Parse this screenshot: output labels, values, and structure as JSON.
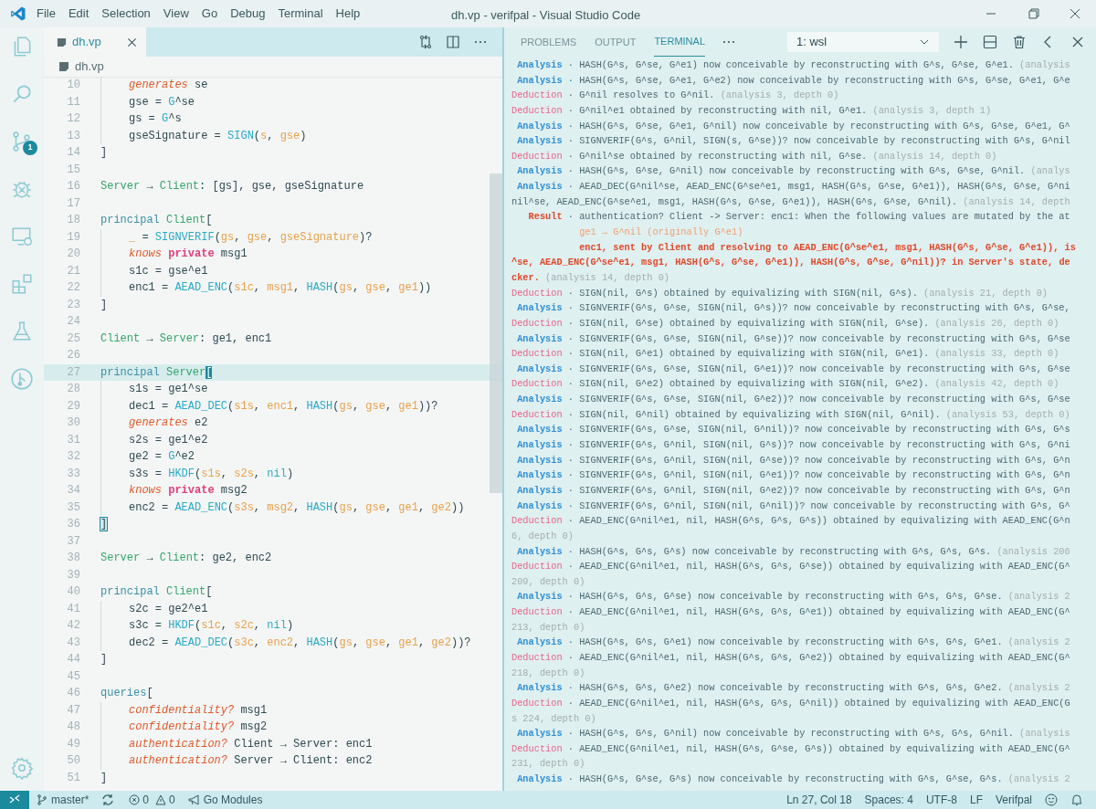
{
  "title_bar": {
    "menu": [
      "File",
      "Edit",
      "Selection",
      "View",
      "Go",
      "Debug",
      "Terminal",
      "Help"
    ],
    "title": "dh.vp - verifpal - Visual Studio Code"
  },
  "activity_bar": {
    "badge": "1"
  },
  "editor": {
    "tabs": [
      {
        "label": "dh.vp",
        "selected": true
      }
    ],
    "breadcrumb": "dh.vp",
    "lines": [
      {
        "num": "10",
        "indent": true,
        "current": false,
        "tokens": [
          {
            "kind": "directive",
            "text": "generates"
          },
          {
            "kind": "plain",
            "text": " se"
          }
        ]
      },
      {
        "num": "11",
        "indent": true,
        "current": false,
        "tokens": [
          {
            "kind": "plain",
            "text": "gse = "
          },
          {
            "kind": "function",
            "text": "G"
          },
          {
            "kind": "plain",
            "text": "^se"
          }
        ]
      },
      {
        "num": "12",
        "indent": true,
        "current": false,
        "tokens": [
          {
            "kind": "plain",
            "text": "gs = "
          },
          {
            "kind": "function",
            "text": "G"
          },
          {
            "kind": "plain",
            "text": "^s"
          }
        ]
      },
      {
        "num": "13",
        "indent": true,
        "current": false,
        "tokens": [
          {
            "kind": "plain",
            "text": "gseSignature = "
          },
          {
            "kind": "function",
            "text": "SIGN"
          },
          {
            "kind": "plain",
            "text": "("
          },
          {
            "kind": "argument",
            "text": "s"
          },
          {
            "kind": "plain",
            "text": ", "
          },
          {
            "kind": "argument",
            "text": "gse"
          },
          {
            "kind": "plain",
            "text": ")"
          }
        ]
      },
      {
        "num": "14",
        "indent": false,
        "current": false,
        "tokens": [
          {
            "kind": "plain",
            "text": "]"
          }
        ]
      },
      {
        "num": "15",
        "indent": false,
        "current": false
      },
      {
        "num": "16",
        "indent": false,
        "current": false,
        "tokens": [
          {
            "kind": "name",
            "text": "Server"
          },
          {
            "kind": "plain",
            "text": " → "
          },
          {
            "kind": "name",
            "text": "Client"
          },
          {
            "kind": "plain",
            "text": ": [gs], gse, gseSignature"
          }
        ]
      },
      {
        "num": "17",
        "indent": false,
        "current": false
      },
      {
        "num": "18",
        "indent": false,
        "current": false,
        "tokens": [
          {
            "kind": "keyword",
            "text": "principal"
          },
          {
            "kind": "name",
            "text": " Client"
          },
          {
            "kind": "plain",
            "text": "["
          }
        ]
      },
      {
        "num": "19",
        "indent": true,
        "current": false,
        "tokens": [
          {
            "kind": "argument",
            "text": "_"
          },
          {
            "kind": "plain",
            "text": " = "
          },
          {
            "kind": "function",
            "text": "SIGNVERIF"
          },
          {
            "kind": "plain",
            "text": "("
          },
          {
            "kind": "argument",
            "text": "gs"
          },
          {
            "kind": "plain",
            "text": ", "
          },
          {
            "kind": "argument",
            "text": "gse"
          },
          {
            "kind": "plain",
            "text": ", "
          },
          {
            "kind": "argument",
            "text": "gseSignature"
          },
          {
            "kind": "plain",
            "text": ")?"
          }
        ]
      },
      {
        "num": "20",
        "indent": true,
        "current": false,
        "tokens": [
          {
            "kind": "directive",
            "text": "knows"
          },
          {
            "kind": "qualifier",
            "text": " private"
          },
          {
            "kind": "plain",
            "text": " msg1"
          }
        ]
      },
      {
        "num": "21",
        "indent": true,
        "current": false,
        "tokens": [
          {
            "kind": "plain",
            "text": "s1c = gse^e1"
          }
        ]
      },
      {
        "num": "22",
        "indent": true,
        "current": false,
        "tokens": [
          {
            "kind": "plain",
            "text": "enc1 = "
          },
          {
            "kind": "function",
            "text": "AEAD_ENC"
          },
          {
            "kind": "plain",
            "text": "("
          },
          {
            "kind": "argument",
            "text": "s1c"
          },
          {
            "kind": "plain",
            "text": ", "
          },
          {
            "kind": "argument",
            "text": "msg1"
          },
          {
            "kind": "plain",
            "text": ", "
          },
          {
            "kind": "function",
            "text": "HASH"
          },
          {
            "kind": "plain",
            "text": "("
          },
          {
            "kind": "argument",
            "text": "gs"
          },
          {
            "kind": "plain",
            "text": ", "
          },
          {
            "kind": "argument",
            "text": "gse"
          },
          {
            "kind": "plain",
            "text": ", "
          },
          {
            "kind": "argument",
            "text": "ge1"
          },
          {
            "kind": "plain",
            "text": "))"
          }
        ]
      },
      {
        "num": "23",
        "indent": false,
        "current": false,
        "tokens": [
          {
            "kind": "plain",
            "text": "]"
          }
        ]
      },
      {
        "num": "24",
        "indent": false,
        "current": false
      },
      {
        "num": "25",
        "indent": false,
        "current": false,
        "tokens": [
          {
            "kind": "name",
            "text": "Client"
          },
          {
            "kind": "plain",
            "text": " → "
          },
          {
            "kind": "name",
            "text": "Server"
          },
          {
            "kind": "plain",
            "text": ": ge1, enc1"
          }
        ]
      },
      {
        "num": "26",
        "indent": false,
        "current": false
      },
      {
        "num": "27",
        "indent": false,
        "current": true,
        "tokens": [
          {
            "kind": "keyword",
            "text": "principal"
          },
          {
            "kind": "name",
            "text": " Server"
          },
          {
            "kind": "cursor",
            "text": "["
          }
        ]
      },
      {
        "num": "28",
        "indent": true,
        "current": false,
        "tokens": [
          {
            "kind": "plain",
            "text": "s1s = ge1^se"
          }
        ]
      },
      {
        "num": "29",
        "indent": true,
        "current": false,
        "tokens": [
          {
            "kind": "plain",
            "text": "dec1 = "
          },
          {
            "kind": "function",
            "text": "AEAD_DEC"
          },
          {
            "kind": "plain",
            "text": "("
          },
          {
            "kind": "argument",
            "text": "s1s"
          },
          {
            "kind": "plain",
            "text": ", "
          },
          {
            "kind": "argument",
            "text": "enc1"
          },
          {
            "kind": "plain",
            "text": ", "
          },
          {
            "kind": "function",
            "text": "HASH"
          },
          {
            "kind": "plain",
            "text": "("
          },
          {
            "kind": "argument",
            "text": "gs"
          },
          {
            "kind": "plain",
            "text": ", "
          },
          {
            "kind": "argument",
            "text": "gse"
          },
          {
            "kind": "plain",
            "text": ", "
          },
          {
            "kind": "argument",
            "text": "ge1"
          },
          {
            "kind": "plain",
            "text": "))?"
          }
        ]
      },
      {
        "num": "30",
        "indent": true,
        "current": false,
        "tokens": [
          {
            "kind": "directive",
            "text": "generates"
          },
          {
            "kind": "plain",
            "text": " e2"
          }
        ]
      },
      {
        "num": "31",
        "indent": true,
        "current": false,
        "tokens": [
          {
            "kind": "plain",
            "text": "s2s = ge1^e2"
          }
        ]
      },
      {
        "num": "32",
        "indent": true,
        "current": false,
        "tokens": [
          {
            "kind": "plain",
            "text": "ge2 = "
          },
          {
            "kind": "function",
            "text": "G"
          },
          {
            "kind": "plain",
            "text": "^e2"
          }
        ]
      },
      {
        "num": "33",
        "indent": true,
        "current": false,
        "tokens": [
          {
            "kind": "plain",
            "text": "s3s = "
          },
          {
            "kind": "function",
            "text": "HKDF"
          },
          {
            "kind": "plain",
            "text": "("
          },
          {
            "kind": "argument",
            "text": "s1s"
          },
          {
            "kind": "plain",
            "text": ", "
          },
          {
            "kind": "argument",
            "text": "s2s"
          },
          {
            "kind": "plain",
            "text": ", "
          },
          {
            "kind": "function",
            "text": "nil"
          },
          {
            "kind": "plain",
            "text": ")"
          }
        ]
      },
      {
        "num": "34",
        "indent": true,
        "current": false,
        "tokens": [
          {
            "kind": "directive",
            "text": "knows"
          },
          {
            "kind": "qualifier",
            "text": " private"
          },
          {
            "kind": "plain",
            "text": " msg2"
          }
        ]
      },
      {
        "num": "35",
        "indent": true,
        "current": false,
        "tokens": [
          {
            "kind": "plain",
            "text": "enc2 = "
          },
          {
            "kind": "function",
            "text": "AEAD_ENC"
          },
          {
            "kind": "plain",
            "text": "("
          },
          {
            "kind": "argument",
            "text": "s3s"
          },
          {
            "kind": "plain",
            "text": ", "
          },
          {
            "kind": "argument",
            "text": "msg2"
          },
          {
            "kind": "plain",
            "text": ", "
          },
          {
            "kind": "function",
            "text": "HASH"
          },
          {
            "kind": "plain",
            "text": "("
          },
          {
            "kind": "argument",
            "text": "gs"
          },
          {
            "kind": "plain",
            "text": ", "
          },
          {
            "kind": "argument",
            "text": "gse"
          },
          {
            "kind": "plain",
            "text": ", "
          },
          {
            "kind": "argument",
            "text": "ge1"
          },
          {
            "kind": "plain",
            "text": ", "
          },
          {
            "kind": "argument",
            "text": "ge2"
          },
          {
            "kind": "plain",
            "text": "))"
          }
        ]
      },
      {
        "num": "36",
        "indent": false,
        "current": false,
        "tokens": [
          {
            "kind": "match",
            "text": "]"
          }
        ]
      },
      {
        "num": "37",
        "indent": false,
        "current": false
      },
      {
        "num": "38",
        "indent": false,
        "current": false,
        "tokens": [
          {
            "kind": "name",
            "text": "Server"
          },
          {
            "kind": "plain",
            "text": " → "
          },
          {
            "kind": "name",
            "text": "Client"
          },
          {
            "kind": "plain",
            "text": ": ge2, enc2"
          }
        ]
      },
      {
        "num": "39",
        "indent": false,
        "current": false
      },
      {
        "num": "40",
        "indent": false,
        "current": false,
        "tokens": [
          {
            "kind": "keyword",
            "text": "principal"
          },
          {
            "kind": "name",
            "text": " Client"
          },
          {
            "kind": "plain",
            "text": "["
          }
        ]
      },
      {
        "num": "41",
        "indent": true,
        "current": false,
        "tokens": [
          {
            "kind": "plain",
            "text": "s2c = ge2^e1"
          }
        ]
      },
      {
        "num": "42",
        "indent": true,
        "current": false,
        "tokens": [
          {
            "kind": "plain",
            "text": "s3c = "
          },
          {
            "kind": "function",
            "text": "HKDF"
          },
          {
            "kind": "plain",
            "text": "("
          },
          {
            "kind": "argument",
            "text": "s1c"
          },
          {
            "kind": "plain",
            "text": ", "
          },
          {
            "kind": "argument",
            "text": "s2c"
          },
          {
            "kind": "plain",
            "text": ", "
          },
          {
            "kind": "function",
            "text": "nil"
          },
          {
            "kind": "plain",
            "text": ")"
          }
        ]
      },
      {
        "num": "43",
        "indent": true,
        "current": false,
        "tokens": [
          {
            "kind": "plain",
            "text": "dec2 = "
          },
          {
            "kind": "function",
            "text": "AEAD_DEC"
          },
          {
            "kind": "plain",
            "text": "("
          },
          {
            "kind": "argument",
            "text": "s3c"
          },
          {
            "kind": "plain",
            "text": ", "
          },
          {
            "kind": "argument",
            "text": "enc2"
          },
          {
            "kind": "plain",
            "text": ", "
          },
          {
            "kind": "function",
            "text": "HASH"
          },
          {
            "kind": "plain",
            "text": "("
          },
          {
            "kind": "argument",
            "text": "gs"
          },
          {
            "kind": "plain",
            "text": ", "
          },
          {
            "kind": "argument",
            "text": "gse"
          },
          {
            "kind": "plain",
            "text": ", "
          },
          {
            "kind": "argument",
            "text": "ge1"
          },
          {
            "kind": "plain",
            "text": ", "
          },
          {
            "kind": "argument",
            "text": "ge2"
          },
          {
            "kind": "plain",
            "text": "))?"
          }
        ]
      },
      {
        "num": "44",
        "indent": false,
        "current": false,
        "tokens": [
          {
            "kind": "plain",
            "text": "]"
          }
        ]
      },
      {
        "num": "45",
        "indent": false,
        "current": false
      },
      {
        "num": "46",
        "indent": false,
        "current": false,
        "tokens": [
          {
            "kind": "keyword",
            "text": "queries"
          },
          {
            "kind": "plain",
            "text": "["
          }
        ]
      },
      {
        "num": "47",
        "indent": true,
        "current": false,
        "tokens": [
          {
            "kind": "directive",
            "text": "confidentiality?"
          },
          {
            "kind": "plain",
            "text": " msg1"
          }
        ]
      },
      {
        "num": "48",
        "indent": true,
        "current": false,
        "tokens": [
          {
            "kind": "directive",
            "text": "confidentiality?"
          },
          {
            "kind": "plain",
            "text": " msg2"
          }
        ]
      },
      {
        "num": "49",
        "indent": true,
        "current": false,
        "tokens": [
          {
            "kind": "directive",
            "text": "authentication?"
          },
          {
            "kind": "plain",
            "text": " Client → Server: enc1"
          }
        ]
      },
      {
        "num": "50",
        "indent": true,
        "current": false,
        "tokens": [
          {
            "kind": "directive",
            "text": "authentication?"
          },
          {
            "kind": "plain",
            "text": " Server → Client: enc2"
          }
        ]
      },
      {
        "num": "51",
        "indent": false,
        "current": false,
        "tokens": [
          {
            "kind": "plain",
            "text": "]"
          }
        ]
      }
    ]
  },
  "panel": {
    "tabs": [
      {
        "label": "PROBLEMS",
        "selected": false
      },
      {
        "label": "OUTPUT",
        "selected": false
      },
      {
        "label": "TERMINAL",
        "selected": true
      }
    ],
    "terminal_select": "1: wsl",
    "lines": [
      {
        "kind": "analysis",
        "label": "Analysis",
        "text": "· HASH(G^s, G^se, G^e1) now conceivable by reconstructing with G^s, G^se, G^e1.",
        "note": "(analysis"
      },
      {
        "kind": "analysis",
        "label": "Analysis",
        "text": "· HASH(G^s, G^se, G^e1, G^e2) now conceivable by reconstructing with G^s, G^se, G^e1, G^e"
      },
      {
        "kind": "deduction",
        "label": "Deduction",
        "text": "· G^nil resolves to G^nil.",
        "note": "(analysis 3, depth 0)"
      },
      {
        "kind": "deduction",
        "label": "Deduction",
        "text": "· G^nil^e1 obtained by reconstructing with nil, G^e1.",
        "note": "(analysis 3, depth 1)"
      },
      {
        "kind": "analysis",
        "label": "Analysis",
        "text": "· HASH(G^s, G^se, G^e1, G^nil) now conceivable by reconstructing with G^s, G^se, G^e1, G^"
      },
      {
        "kind": "analysis",
        "label": "Analysis",
        "text": "· SIGNVERIF(G^s, G^nil, SIGN(s, G^se))? now conceivable by reconstructing with G^s, G^nil"
      },
      {
        "kind": "deduction",
        "label": "Deduction",
        "text": "· G^nil^se obtained by reconstructing with nil, G^se.",
        "note": "(analysis 14, depth 0)"
      },
      {
        "kind": "analysis",
        "label": "Analysis",
        "text": "· HASH(G^s, G^se, G^nil) now conceivable by reconstructing with G^s, G^se, G^nil.",
        "note": "(analys"
      },
      {
        "kind": "analysis",
        "label": "Analysis",
        "text": "· AEAD_DEC(G^nil^se, AEAD_ENC(G^se^e1, msg1, HASH(G^s, G^se, G^e1)), HASH(G^s, G^se, G^ni"
      },
      {
        "kind": "continuation",
        "text": "nil^se, AEAD_ENC(G^se^e1, msg1, HASH(G^s, G^se, G^e1)), HASH(G^s, G^se, G^nil).",
        "note": "(analysis 14, depth"
      },
      {
        "kind": "result",
        "label": "Result",
        "text": "· authentication? Client -> Server: enc1: When the following values are mutated by the at"
      },
      {
        "kind": "mutation",
        "text": "ge1 → G^nil (originally G^e1)"
      },
      {
        "kind": "verdict",
        "indent": true,
        "text": "enc1, sent by Client and resolving to AEAD_ENC(G^se^e1, msg1, HASH(G^s, G^se, G^e1)), is"
      },
      {
        "kind": "verdict",
        "indent": false,
        "text": "^se, AEAD_ENC(G^se^e1, msg1, HASH(G^s, G^se, G^e1)), HASH(G^s, G^se, G^nil))? in Server's state, de"
      },
      {
        "kind": "verdict",
        "indent": false,
        "text": "cker.",
        "note": "(analysis 14, depth 0)"
      },
      {
        "kind": "deduction",
        "label": "Deduction",
        "text": "· SIGN(nil, G^s) obtained by equivalizing with SIGN(nil, G^s).",
        "note": "(analysis 21, depth 0)"
      },
      {
        "kind": "analysis",
        "label": "Analysis",
        "text": "· SIGNVERIF(G^s, G^se, SIGN(nil, G^s))? now conceivable by reconstructing with G^s, G^se,"
      },
      {
        "kind": "deduction",
        "label": "Deduction",
        "text": "· SIGN(nil, G^se) obtained by equivalizing with SIGN(nil, G^se).",
        "note": "(analysis 26, depth 0)"
      },
      {
        "kind": "analysis",
        "label": "Analysis",
        "text": "· SIGNVERIF(G^s, G^se, SIGN(nil, G^se))? now conceivable by reconstructing with G^s, G^se"
      },
      {
        "kind": "deduction",
        "label": "Deduction",
        "text": "· SIGN(nil, G^e1) obtained by equivalizing with SIGN(nil, G^e1).",
        "note": "(analysis 33, depth 0)"
      },
      {
        "kind": "analysis",
        "label": "Analysis",
        "text": "· SIGNVERIF(G^s, G^se, SIGN(nil, G^e1))? now conceivable by reconstructing with G^s, G^se"
      },
      {
        "kind": "deduction",
        "label": "Deduction",
        "text": "· SIGN(nil, G^e2) obtained by equivalizing with SIGN(nil, G^e2).",
        "note": "(analysis 42, depth 0)"
      },
      {
        "kind": "analysis",
        "label": "Analysis",
        "text": "· SIGNVERIF(G^s, G^se, SIGN(nil, G^e2))? now conceivable by reconstructing with G^s, G^se"
      },
      {
        "kind": "deduction",
        "label": "Deduction",
        "text": "· SIGN(nil, G^nil) obtained by equivalizing with SIGN(nil, G^nil).",
        "note": "(analysis 53, depth 0)"
      },
      {
        "kind": "analysis",
        "label": "Analysis",
        "text": "· SIGNVERIF(G^s, G^se, SIGN(nil, G^nil))? now conceivable by reconstructing with G^s, G^s"
      },
      {
        "kind": "analysis",
        "label": "Analysis",
        "text": "· SIGNVERIF(G^s, G^nil, SIGN(nil, G^s))? now conceivable by reconstructing with G^s, G^ni"
      },
      {
        "kind": "analysis",
        "label": "Analysis",
        "text": "· SIGNVERIF(G^s, G^nil, SIGN(nil, G^se))? now conceivable by reconstructing with G^s, G^n"
      },
      {
        "kind": "analysis",
        "label": "Analysis",
        "text": "· SIGNVERIF(G^s, G^nil, SIGN(nil, G^e1))? now conceivable by reconstructing with G^s, G^n"
      },
      {
        "kind": "analysis",
        "label": "Analysis",
        "text": "· SIGNVERIF(G^s, G^nil, SIGN(nil, G^e2))? now conceivable by reconstructing with G^s, G^n"
      },
      {
        "kind": "analysis",
        "label": "Analysis",
        "text": "· SIGNVERIF(G^s, G^nil, SIGN(nil, G^nil))? now conceivable by reconstructing with G^s, G^"
      },
      {
        "kind": "deduction",
        "label": "Deduction",
        "text": "· AEAD_ENC(G^nil^e1, nil, HASH(G^s, G^s, G^s)) obtained by equivalizing with AEAD_ENC(G^n"
      },
      {
        "kind": "continuation",
        "note": "6, depth 0)"
      },
      {
        "kind": "analysis",
        "label": "Analysis",
        "text": "· HASH(G^s, G^s, G^s) now conceivable by reconstructing with G^s, G^s, G^s.",
        "note": "(analysis 206"
      },
      {
        "kind": "deduction",
        "label": "Deduction",
        "text": "· AEAD_ENC(G^nil^e1, nil, HASH(G^s, G^s, G^se)) obtained by equivalizing with AEAD_ENC(G^"
      },
      {
        "kind": "continuation",
        "note": "209, depth 0)"
      },
      {
        "kind": "analysis",
        "label": "Analysis",
        "text": "· HASH(G^s, G^s, G^se) now conceivable by reconstructing with G^s, G^s, G^se.",
        "note": "(analysis 2"
      },
      {
        "kind": "deduction",
        "label": "Deduction",
        "text": "· AEAD_ENC(G^nil^e1, nil, HASH(G^s, G^s, G^e1)) obtained by equivalizing with AEAD_ENC(G^"
      },
      {
        "kind": "continuation",
        "note": "213, depth 0)"
      },
      {
        "kind": "analysis",
        "label": "Analysis",
        "text": "· HASH(G^s, G^s, G^e1) now conceivable by reconstructing with G^s, G^s, G^e1.",
        "note": "(analysis 2"
      },
      {
        "kind": "deduction",
        "label": "Deduction",
        "text": "· AEAD_ENC(G^nil^e1, nil, HASH(G^s, G^s, G^e2)) obtained by equivalizing with AEAD_ENC(G^"
      },
      {
        "kind": "continuation",
        "note": "218, depth 0)"
      },
      {
        "kind": "analysis",
        "label": "Analysis",
        "text": "· HASH(G^s, G^s, G^e2) now conceivable by reconstructing with G^s, G^s, G^e2.",
        "note": "(analysis 2"
      },
      {
        "kind": "deduction",
        "label": "Deduction",
        "text": "· AEAD_ENC(G^nil^e1, nil, HASH(G^s, G^s, G^nil)) obtained by equivalizing with AEAD_ENC(G"
      },
      {
        "kind": "continuation",
        "note": "s 224, depth 0)"
      },
      {
        "kind": "analysis",
        "label": "Analysis",
        "text": "· HASH(G^s, G^s, G^nil) now conceivable by reconstructing with G^s, G^s, G^nil.",
        "note": "(analysis"
      },
      {
        "kind": "deduction",
        "label": "Deduction",
        "text": "· AEAD_ENC(G^nil^e1, nil, HASH(G^s, G^se, G^s)) obtained by equivalizing with AEAD_ENC(G^"
      },
      {
        "kind": "continuation",
        "note": "231, depth 0)"
      },
      {
        "kind": "analysis",
        "label": "Analysis",
        "text": "· HASH(G^s, G^se, G^s) now conceivable by reconstructing with G^s, G^se, G^s.",
        "note": "(analysis 2"
      }
    ]
  },
  "status_bar": {
    "branch": "master*",
    "errors": "0",
    "warnings": "0",
    "go_modules": "Go Modules",
    "position": "Ln 27, Col 18",
    "spaces": "Spaces: 4",
    "encoding": "UTF-8",
    "eol": "LF",
    "language": "Verifpal"
  }
}
